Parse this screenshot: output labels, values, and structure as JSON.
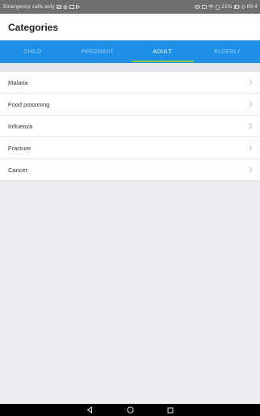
{
  "status_bar": {
    "left_text": "Emergency calls only",
    "battery": "21%",
    "time": "00:4"
  },
  "header": {
    "title": "Categories"
  },
  "tabs": [
    {
      "label": "CHILD",
      "active": false
    },
    {
      "label": "PREGNANT",
      "active": false
    },
    {
      "label": "ADULT",
      "active": true
    },
    {
      "label": "ELDERLY",
      "active": false
    }
  ],
  "categories": [
    {
      "label": "Malaria"
    },
    {
      "label": "Food poisoning"
    },
    {
      "label": "Influenza"
    },
    {
      "label": "Fracture"
    },
    {
      "label": "Cancer"
    }
  ],
  "colors": {
    "tab_bar": "#1e8fe6",
    "tab_indicator": "#8bc34a",
    "background": "#eeedf2"
  },
  "icons": {
    "list_item": "chevron-right-icon",
    "nav_back": "back-triangle-icon",
    "nav_home": "home-circle-icon",
    "nav_recents": "recents-square-icon"
  }
}
